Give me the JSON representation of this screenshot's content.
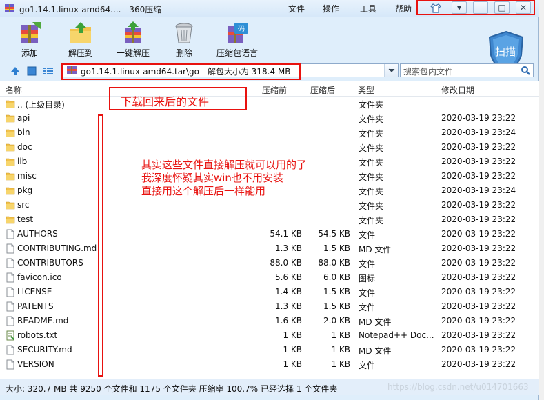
{
  "window": {
    "title": "go1.14.1.linux-amd64.... - 360压缩",
    "menu": [
      "文件",
      "操作",
      "工具",
      "帮助"
    ]
  },
  "toolbar": {
    "buttons": [
      {
        "label": "添加",
        "icon": "add-books-icon"
      },
      {
        "label": "解压到",
        "icon": "extract-folder-icon"
      },
      {
        "label": "一键解压",
        "icon": "oneclick-extract-icon"
      },
      {
        "label": "删除",
        "icon": "trash-icon"
      },
      {
        "label": "压缩包语言",
        "icon": "archive-language-icon"
      }
    ],
    "scan_label": "扫描"
  },
  "address": {
    "path": "go1.14.1.linux-amd64.tar\\go - 解包大小为 318.4 MB",
    "search_placeholder": "搜索包内文件"
  },
  "columns": {
    "name": "名称",
    "packed": "压缩前",
    "unpacked": "压缩后",
    "type": "类型",
    "modified": "修改日期"
  },
  "files": [
    {
      "name": ".. (上级目录)",
      "kind": "folder",
      "packed": "",
      "unpacked": "",
      "type": "文件夹",
      "date": ""
    },
    {
      "name": "api",
      "kind": "folder",
      "packed": "",
      "unpacked": "",
      "type": "文件夹",
      "date": "2020-03-19 23:22"
    },
    {
      "name": "bin",
      "kind": "folder",
      "packed": "",
      "unpacked": "",
      "type": "文件夹",
      "date": "2020-03-19 23:24"
    },
    {
      "name": "doc",
      "kind": "folder",
      "packed": "",
      "unpacked": "",
      "type": "文件夹",
      "date": "2020-03-19 23:22"
    },
    {
      "name": "lib",
      "kind": "folder",
      "packed": "",
      "unpacked": "",
      "type": "文件夹",
      "date": "2020-03-19 23:22"
    },
    {
      "name": "misc",
      "kind": "folder",
      "packed": "",
      "unpacked": "",
      "type": "文件夹",
      "date": "2020-03-19 23:22"
    },
    {
      "name": "pkg",
      "kind": "folder",
      "packed": "",
      "unpacked": "",
      "type": "文件夹",
      "date": "2020-03-19 23:24"
    },
    {
      "name": "src",
      "kind": "folder",
      "packed": "",
      "unpacked": "",
      "type": "文件夹",
      "date": "2020-03-19 23:22"
    },
    {
      "name": "test",
      "kind": "folder",
      "packed": "",
      "unpacked": "",
      "type": "文件夹",
      "date": "2020-03-19 23:22"
    },
    {
      "name": "AUTHORS",
      "kind": "file",
      "packed": "54.1 KB",
      "unpacked": "54.5 KB",
      "type": "文件",
      "date": "2020-03-19 23:22"
    },
    {
      "name": "CONTRIBUTING.md",
      "kind": "file",
      "packed": "1.3 KB",
      "unpacked": "1.5 KB",
      "type": "MD 文件",
      "date": "2020-03-19 23:22"
    },
    {
      "name": "CONTRIBUTORS",
      "kind": "file",
      "packed": "88.0 KB",
      "unpacked": "88.0 KB",
      "type": "文件",
      "date": "2020-03-19 23:22"
    },
    {
      "name": "favicon.ico",
      "kind": "file",
      "packed": "5.6 KB",
      "unpacked": "6.0 KB",
      "type": "图标",
      "date": "2020-03-19 23:22"
    },
    {
      "name": "LICENSE",
      "kind": "file",
      "packed": "1.4 KB",
      "unpacked": "1.5 KB",
      "type": "文件",
      "date": "2020-03-19 23:22"
    },
    {
      "name": "PATENTS",
      "kind": "file",
      "packed": "1.3 KB",
      "unpacked": "1.5 KB",
      "type": "文件",
      "date": "2020-03-19 23:22"
    },
    {
      "name": "README.md",
      "kind": "file",
      "packed": "1.6 KB",
      "unpacked": "2.0 KB",
      "type": "MD 文件",
      "date": "2020-03-19 23:22"
    },
    {
      "name": "robots.txt",
      "kind": "txt",
      "packed": "1 KB",
      "unpacked": "1 KB",
      "type": "Notepad++ Doc...",
      "date": "2020-03-19 23:22"
    },
    {
      "name": "SECURITY.md",
      "kind": "file",
      "packed": "1 KB",
      "unpacked": "1 KB",
      "type": "MD 文件",
      "date": "2020-03-19 23:22"
    },
    {
      "name": "VERSION",
      "kind": "file",
      "packed": "1 KB",
      "unpacked": "1 KB",
      "type": "文件",
      "date": "2020-03-19 23:22"
    }
  ],
  "status": "大小: 320.7 MB 共 9250 个文件和 1175 个文件夹 压缩率 100.7% 已经选择 1 个文件夹",
  "watermark": "https://blog.csdn.net/u014701663",
  "annotations": {
    "downloaded": "下载回来后的文件",
    "note_lines": [
      "其实这些文件直接解压就可以用的了",
      "我深度怀疑其实win也不用安装",
      "直接用这个解压后一样能用"
    ]
  },
  "colors": {
    "annotation_red": "#e8120f",
    "folder_yellow": "#f2c24b",
    "window_bg": "#dfeefb"
  }
}
